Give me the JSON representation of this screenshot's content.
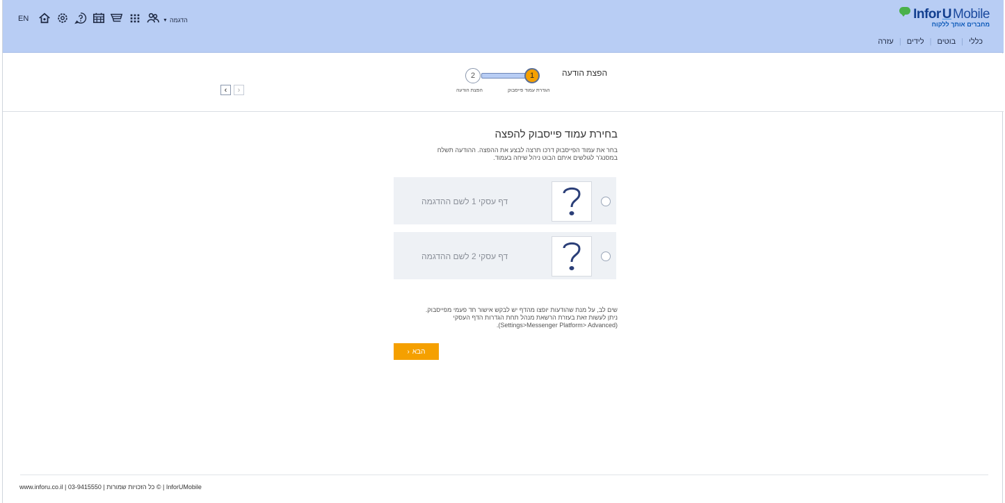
{
  "header": {
    "lang": "EN",
    "demo_user": "הדגמה",
    "brand_main": "Infor",
    "brand_u": "U",
    "brand_mobile": "Mobile",
    "tagline": "מחברים אותך ללקוח",
    "nav": [
      "כללי",
      "בוטים",
      "לידים",
      "עזרה"
    ]
  },
  "icons": [
    "home-icon",
    "settings-icon",
    "help-icon",
    "calendar-icon",
    "cart-icon",
    "apps-icon",
    "users-icon"
  ],
  "wizard": {
    "title": "הפצת הודעה",
    "step1_num": "1",
    "step2_num": "2",
    "step1_label": "הגדרת עמוד פייסבוק",
    "step2_label": "הפצת הודעה",
    "prev": "‹",
    "next": "›",
    "current_step": 1
  },
  "main": {
    "heading": "בחירת עמוד פייסבוק להפצה",
    "desc_line1": "בחר את עמוד הפייסבוק דרכו תרצה לבצע את ההפצה. ההודעה תשלח",
    "desc_line2": "במסנג'ר לגולשים איתם הבוט ניהל שיחה בעמוד.",
    "pages": [
      {
        "name": "דף עסקי 1 לשם ההדגמה",
        "selected": false
      },
      {
        "name": "דף עסקי 2 לשם ההדגמה",
        "selected": false
      }
    ],
    "note_line1": "שים לב, על מנת שהודעות יופצו מהדף יש לבקש אישור חד פעמי מפייסבוק.",
    "note_line2": "ניתן לעשות זאת בעזרת הרשאת מנהל תחת הגדרות הדף העסקי",
    "note_line3": "(Settings>Messenger Platform> Advanced).",
    "next_button": "הבא",
    "next_arrow": "‹"
  },
  "footer": {
    "text": "www.inforu.co.il | 03-9415550 | כל הזכויות שמורות © | InforUMobile"
  },
  "colors": {
    "header_bg": "#b8cdf4",
    "accent": "#f5a000",
    "card_bg": "#eef1f5"
  }
}
